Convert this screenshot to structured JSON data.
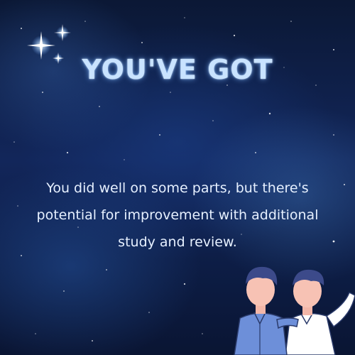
{
  "headline": "YOU'VE GOT",
  "message": "You did well on some parts, but there's potential for improvement with additional study and review.",
  "icons": {
    "sparkles": "sparkle-cluster-icon",
    "illustration": "two-people-illustration"
  },
  "colors": {
    "background": "#12265a",
    "headline": "#c9e3ff",
    "text": "#e6f0ff"
  }
}
